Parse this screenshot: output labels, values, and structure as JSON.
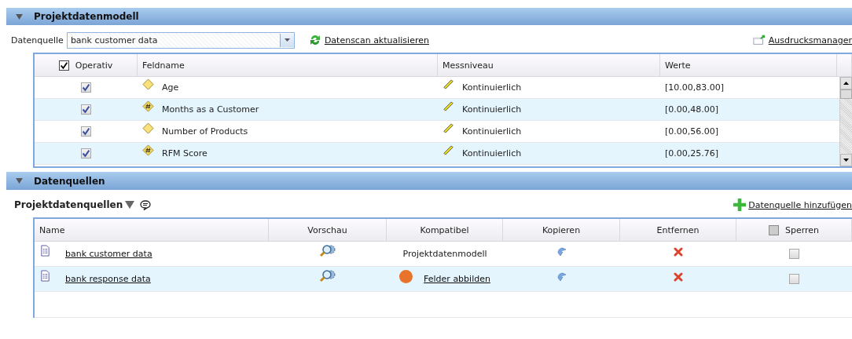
{
  "model_section": {
    "title": "Projektdatenmodell",
    "expanded": true,
    "source_label": "Datenquelle",
    "source_value": "bank customer data",
    "rescan_link": "Datenscan aktualisieren",
    "expressions_link": "Ausdrucksmanager",
    "columns": [
      "Operativ",
      "Feldname",
      "Messniveau",
      "Werte"
    ],
    "all_operative": true,
    "rows": [
      {
        "operative": true,
        "kind": "plain",
        "name": "Age",
        "level_name": "Kontinuierlich",
        "values": "[10.00,83.00]"
      },
      {
        "operative": true,
        "kind": "hash",
        "name": "Months as a Customer",
        "level_name": "Kontinuierlich",
        "values": "[0.00,48.00]"
      },
      {
        "operative": true,
        "kind": "plain",
        "name": "Number of Products",
        "level_name": "Kontinuierlich",
        "values": "[0.00,56.00]"
      },
      {
        "operative": true,
        "kind": "hash",
        "name": "RFM Score",
        "level_name": "Kontinuierlich",
        "values": "[0.00,25.76]"
      }
    ]
  },
  "sources_section": {
    "title": "Datenquellen",
    "expanded": true,
    "subtitle": "Projektdatenquellen",
    "add_link": "Datenquelle hinzufügen",
    "columns": [
      "Name",
      "Vorschau",
      "Kompatibel",
      "Kopieren",
      "Entfernen",
      "Sperren"
    ],
    "all_locked": false,
    "rows": [
      {
        "name": "bank customer data",
        "kind": "text",
        "compat": "Projektdatenmodell",
        "locked": false
      },
      {
        "name": "bank response data",
        "kind": "link",
        "compat": "Felder abbilden",
        "color": "#e8732a",
        "locked": false
      }
    ]
  }
}
